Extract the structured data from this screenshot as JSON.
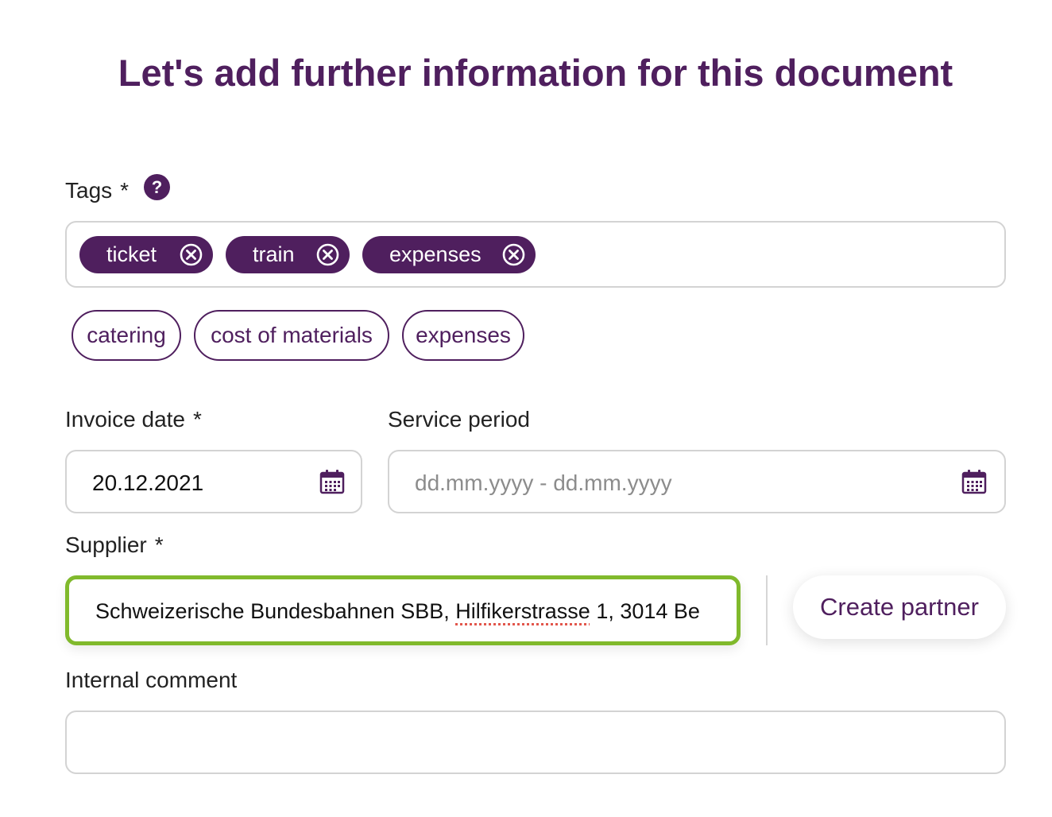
{
  "title": "Let's add further information for this document",
  "tags": {
    "label": "Tags",
    "required": "*",
    "help_icon": "?",
    "selected": [
      {
        "label": "ticket"
      },
      {
        "label": "train"
      },
      {
        "label": "expenses"
      }
    ],
    "suggestions": [
      {
        "label": "catering"
      },
      {
        "label": "cost of materials"
      },
      {
        "label": "expenses"
      }
    ]
  },
  "invoice_date": {
    "label": "Invoice date",
    "required": "*",
    "value": "20.12.2021",
    "icon": "calendar-icon"
  },
  "service_period": {
    "label": "Service period",
    "placeholder": "dd.mm.yyyy - dd.mm.yyyy",
    "icon": "calendar-icon"
  },
  "supplier": {
    "label": "Supplier",
    "required": "*",
    "value_before": "Schweizerische Bundesbahnen SBB, ",
    "value_flagged": "Hilfikerstrasse",
    "value_after": " 1, 3014 Be",
    "create_label": "Create partner"
  },
  "internal_comment": {
    "label": "Internal comment",
    "value": ""
  },
  "colors": {
    "brand": "#4f1f5e",
    "focus": "#80b92c",
    "border": "#d3d3d3",
    "spellcheck": "#e2574c"
  }
}
